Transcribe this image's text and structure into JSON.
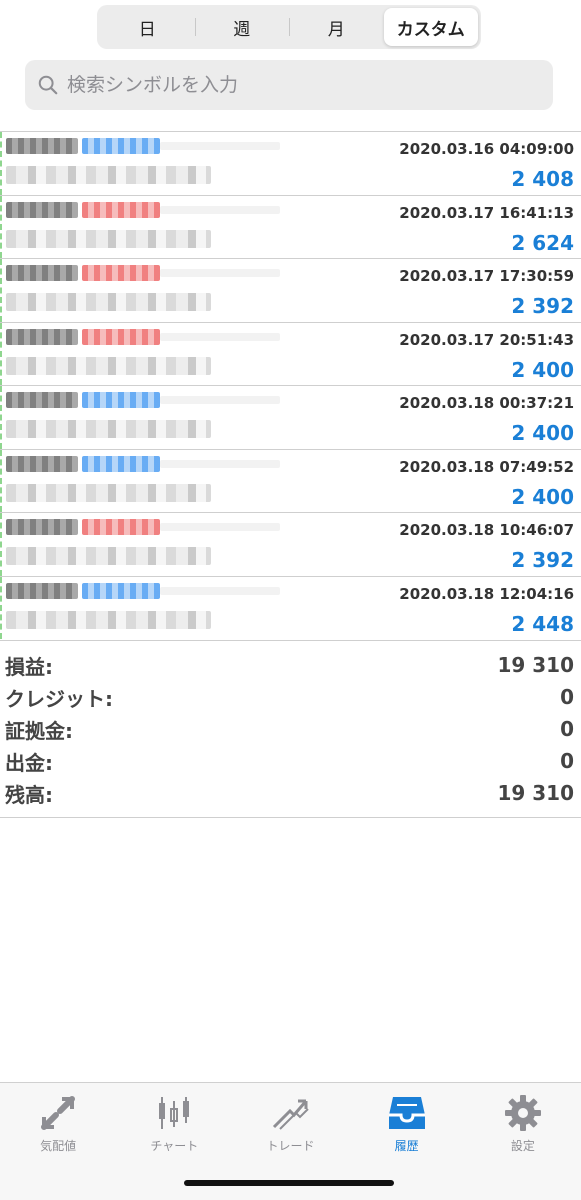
{
  "segments": [
    "日",
    "週",
    "月",
    "カスタム"
  ],
  "active_segment": 3,
  "search": {
    "placeholder": "検索シンボルを入力",
    "value": ""
  },
  "deals": [
    {
      "time": "2020.03.16 04:09:00",
      "profit": "2 408",
      "side": "buy"
    },
    {
      "time": "2020.03.17 16:41:13",
      "profit": "2 624",
      "side": "sell"
    },
    {
      "time": "2020.03.17 17:30:59",
      "profit": "2 392",
      "side": "sell"
    },
    {
      "time": "2020.03.17 20:51:43",
      "profit": "2 400",
      "side": "sell"
    },
    {
      "time": "2020.03.18 00:37:21",
      "profit": "2 400",
      "side": "buy"
    },
    {
      "time": "2020.03.18 07:49:52",
      "profit": "2 400",
      "side": "buy"
    },
    {
      "time": "2020.03.18 10:46:07",
      "profit": "2 392",
      "side": "sell"
    },
    {
      "time": "2020.03.18 12:04:16",
      "profit": "2 448",
      "side": "buy"
    }
  ],
  "summary": [
    {
      "label": "損益:",
      "value": "19 310"
    },
    {
      "label": "クレジット:",
      "value": "0"
    },
    {
      "label": "証拠金:",
      "value": "0"
    },
    {
      "label": "出金:",
      "value": "0"
    },
    {
      "label": "残高:",
      "value": "19 310"
    }
  ],
  "tabs": [
    {
      "label": "気配値",
      "icon": "quotes-icon"
    },
    {
      "label": "チャート",
      "icon": "chart-icon"
    },
    {
      "label": "トレード",
      "icon": "trade-icon"
    },
    {
      "label": "履歴",
      "icon": "history-icon"
    },
    {
      "label": "設定",
      "icon": "settings-icon"
    }
  ],
  "active_tab": 3,
  "colors": {
    "accent": "#1a7fd6",
    "buy": "#4e9ef2",
    "sell": "#ee6a6a"
  }
}
